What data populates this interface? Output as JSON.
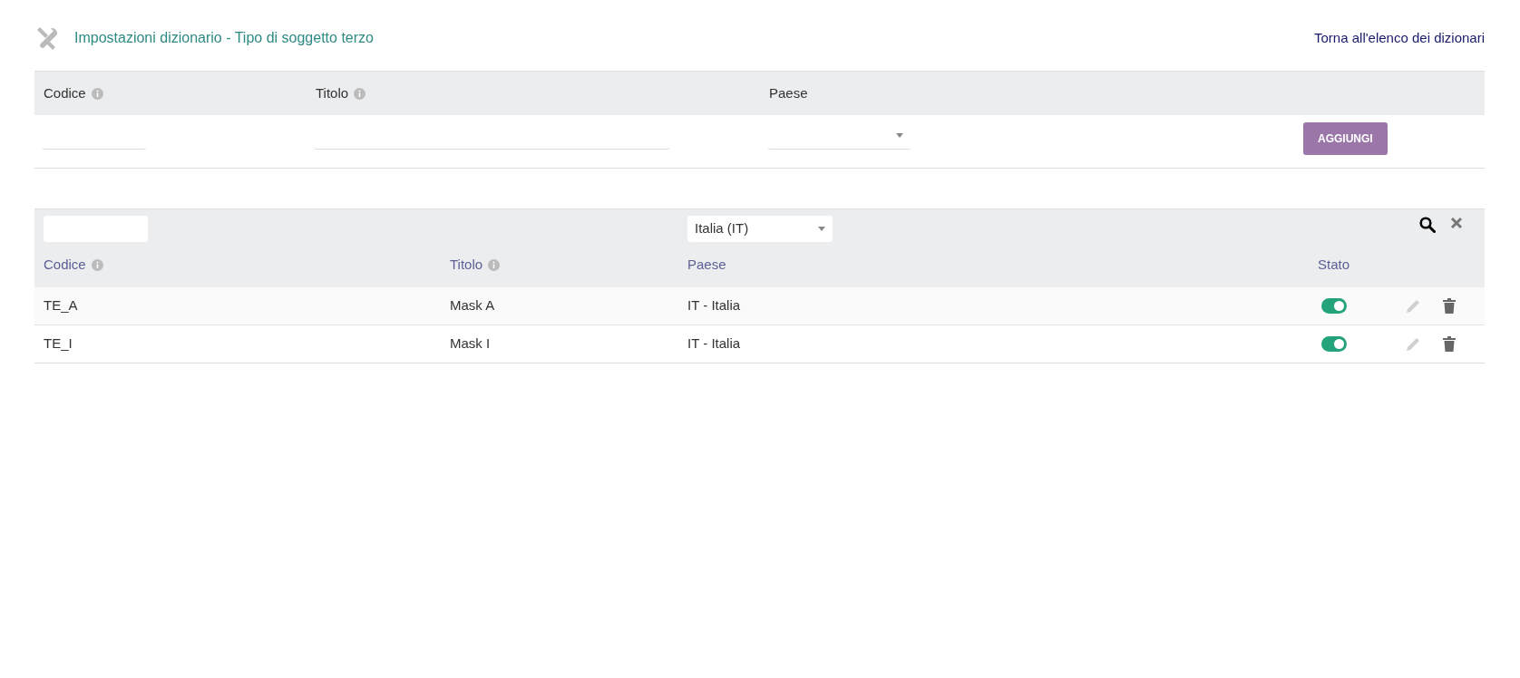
{
  "header": {
    "title": "Impostazioni dizionario - Tipo di soggetto terzo",
    "back_link": "Torna all'elenco dei dizionari"
  },
  "form": {
    "columns": [
      {
        "label": "Codice",
        "info": true
      },
      {
        "label": "Titolo",
        "info": true
      },
      {
        "label": "Paese",
        "info": false
      }
    ],
    "add_button": "AGGIUNGI"
  },
  "table": {
    "filter": {
      "country": "Italia (IT)"
    },
    "columns": [
      {
        "label": "Codice",
        "info": true
      },
      {
        "label": "Titolo",
        "info": true
      },
      {
        "label": "Paese",
        "info": false
      },
      {
        "label": "Stato",
        "info": false
      }
    ],
    "rows": [
      {
        "codice": "TE_A",
        "titolo": "Mask A",
        "paese": "IT - Italia",
        "on": true,
        "edit_disabled": true
      },
      {
        "codice": "TE_I",
        "titolo": "Mask I",
        "paese": "IT - Italia",
        "on": true,
        "edit_disabled": true
      }
    ]
  }
}
